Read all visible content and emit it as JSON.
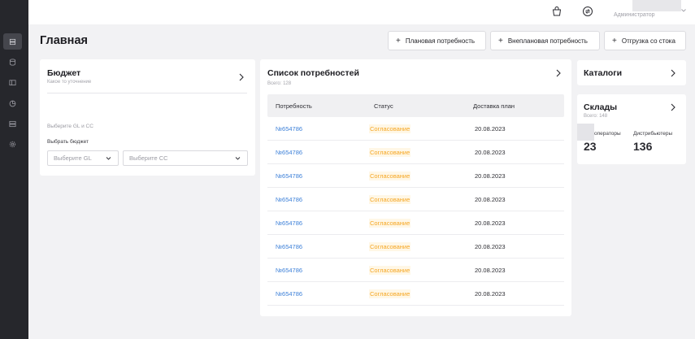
{
  "header": {
    "role": "Администратор"
  },
  "page": {
    "title": "Главная"
  },
  "actions": {
    "planned": "Плановая потребность",
    "unplanned": "Внеплановая потребность",
    "shipment": "Отгрузка со стока"
  },
  "budget": {
    "title": "Бюджет",
    "subtitle": "Какое то уточнение",
    "hint": "Выберите GL и CC",
    "select_label": "Выбрать бюджет",
    "gl_placeholder": "Выберите GL",
    "cc_placeholder": "Выберите CC"
  },
  "needs": {
    "title": "Список потребностей",
    "total": "Всего: 128",
    "columns": [
      "Потребность",
      "Статус",
      "Доставка план"
    ],
    "rows": [
      {
        "id": "№654786",
        "status": "Согласование",
        "date": "20.08.2023"
      },
      {
        "id": "№654786",
        "status": "Согласование",
        "date": "20.08.2023"
      },
      {
        "id": "№654786",
        "status": "Согласование",
        "date": "20.08.2023"
      },
      {
        "id": "№654786",
        "status": "Согласование",
        "date": "20.08.2023"
      },
      {
        "id": "№654786",
        "status": "Согласование",
        "date": "20.08.2023"
      },
      {
        "id": "№654786",
        "status": "Согласование",
        "date": "20.08.2023"
      },
      {
        "id": "№654786",
        "status": "Согласование",
        "date": "20.08.2023"
      },
      {
        "id": "№654786",
        "status": "Согласование",
        "date": "20.08.2023"
      }
    ]
  },
  "catalogs": {
    "title": "Каталоги"
  },
  "warehouses": {
    "title": "Склады",
    "total": "Всего: 148",
    "operators_label": "операторы",
    "operators_value": "23",
    "distributors_label": "Дистрибьютеры",
    "distributors_value": "136"
  },
  "colors": {
    "sidebar": "#26272c",
    "link": "#3d80d8",
    "status": "#f5a623"
  },
  "icons": {
    "sidebar": [
      "layers-icon",
      "database-icon",
      "sidebar-panel-icon",
      "chart-icon",
      "stack-icon",
      "gear-icon"
    ],
    "topbar": [
      "basket-icon",
      "refresh-icon",
      "chevron-down-icon"
    ]
  }
}
